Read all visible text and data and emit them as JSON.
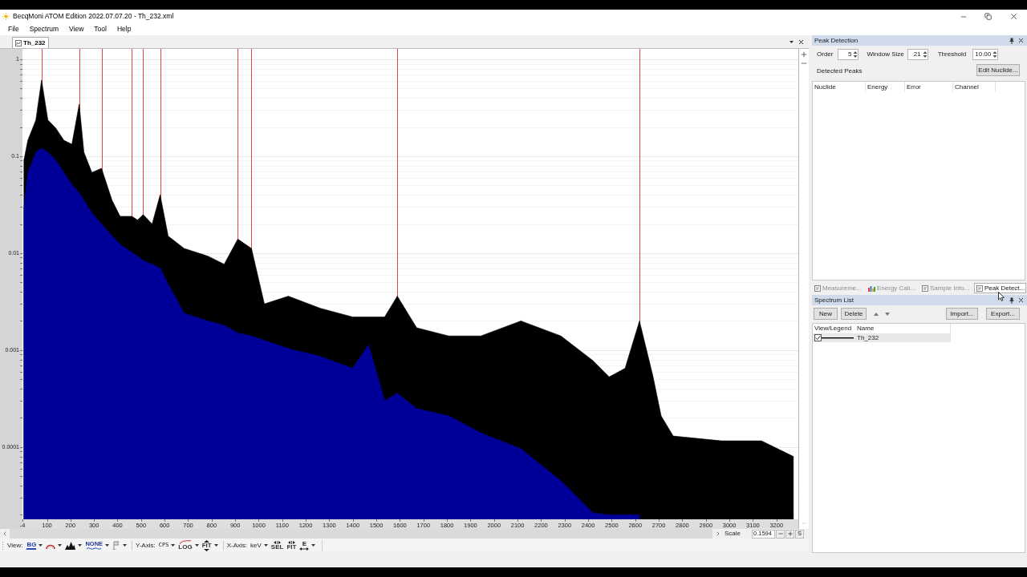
{
  "window": {
    "title": "BecqMoni ATOM Edition 2022.07.07.20 - Th_232.xml"
  },
  "menu": [
    "File",
    "Spectrum",
    "View",
    "Tool",
    "Help"
  ],
  "document_tabs": [
    {
      "label": "Th_232",
      "selected": true
    }
  ],
  "spectrum_view": {
    "chart_data": [
      {
        "type": "area",
        "log": true,
        "grid": true,
        "x": [
          2,
          19,
          53,
          77,
          104,
          138,
          172,
          206,
          237,
          257,
          291,
          332,
          377,
          411,
          461,
          485,
          509,
          547,
          581,
          615,
          683,
          785,
          853,
          911,
          969,
          1024,
          1126,
          1262,
          1399,
          1467,
          1535,
          1589,
          1671,
          1807,
          1944,
          2114,
          2284,
          2420,
          2489,
          2557,
          2618,
          2676,
          2710,
          2761,
          2966,
          3136,
          3272
        ],
        "series": [
          {
            "color": "#000000",
            "values": [
              0.091,
              0.146,
              0.236,
              0.61,
              0.236,
              0.195,
              0.146,
              0.133,
              0.344,
              0.11,
              0.068,
              0.075,
              0.035,
              0.024,
              0.024,
              0.022,
              0.025,
              0.02,
              0.04,
              0.015,
              0.0112,
              0.0093,
              0.0077,
              0.014,
              0.0112,
              0.003,
              0.0036,
              0.0027,
              0.0022,
              0.0022,
              0.0022,
              0.0036,
              0.0017,
              0.0014,
              0.0014,
              0.002,
              0.0014,
              0.00078,
              0.00053,
              0.00065,
              0.002,
              0.00053,
              0.00021,
              0.00013,
              0.000116,
              0.000116,
              8e-05
            ]
          },
          {
            "color": "#000099",
            "values": [
              0.029,
              0.068,
              0.11,
              0.121,
              0.11,
              0.091,
              0.068,
              0.051,
              0.042,
              0.035,
              0.026,
              0.02,
              0.015,
              0.0123,
              0.0102,
              0.0093,
              0.0084,
              0.0077,
              0.007,
              0.0048,
              0.0024,
              0.002,
              0.0018,
              0.0015,
              0.0014,
              0.00126,
              0.00104,
              0.00086,
              0.00065,
              0.00114,
              0.0003,
              0.00036,
              0.00025,
              0.00021,
              0.00014,
              9.6e-05,
              4.5e-05,
              2.1e-05,
              2e-05,
              2e-05,
              2e-05,
              null,
              null,
              null,
              null,
              null,
              null
            ]
          }
        ],
        "xlim": [
          -4,
          3293
        ],
        "ylim": [
          1.8e-05,
          1.28
        ],
        "xticks": [
          -4,
          100,
          200,
          300,
          400,
          500,
          600,
          700,
          800,
          900,
          1000,
          1100,
          1200,
          1300,
          1400,
          1500,
          1600,
          1700,
          1800,
          1900,
          2000,
          2100,
          2200,
          2300,
          2400,
          2500,
          2600,
          2700,
          2800,
          2900,
          3000,
          3100,
          3200
        ],
        "yticks": [
          1,
          0.1,
          0.01,
          0.001,
          0.0001
        ],
        "ref_lines": [
          {
            "axis": "x",
            "value": 77,
            "color": "#e04848"
          },
          {
            "axis": "x",
            "value": 237,
            "color": "#e04848"
          },
          {
            "axis": "x",
            "value": 332,
            "color": "#e04848"
          },
          {
            "axis": "x",
            "value": 461,
            "color": "#e04848"
          },
          {
            "axis": "x",
            "value": 509,
            "color": "#e04848"
          },
          {
            "axis": "x",
            "value": 581,
            "color": "#e04848"
          },
          {
            "axis": "x",
            "value": 911,
            "color": "#e04848"
          },
          {
            "axis": "x",
            "value": 969,
            "color": "#e04848"
          },
          {
            "axis": "x",
            "value": 1589,
            "color": "#e04848"
          },
          {
            "axis": "x",
            "value": 2618,
            "color": "#e04848"
          }
        ]
      }
    ],
    "scale": {
      "label": "Scale",
      "value": "0.1594",
      "reset": "S"
    }
  },
  "toolbar": {
    "view": {
      "label": "View:",
      "icon_texts": [
        "BG",
        "NONE"
      ]
    },
    "y_axis": {
      "label": "Y-Axis:",
      "unit": "CPS",
      "icon_texts": [
        "LOG",
        "FIT"
      ]
    },
    "x_axis": {
      "label": "X-Axis:",
      "unit": "keV",
      "icon_texts": [
        "SEL",
        "FIT",
        "E"
      ]
    }
  },
  "peak_detection": {
    "title": "Peak Detection",
    "params": [
      {
        "label": "Order",
        "value": "5"
      },
      {
        "label": "Window Size",
        "value": "21"
      },
      {
        "label": "Threshold",
        "value": "10.00"
      }
    ],
    "edit_button": "Edit Nuclide...",
    "list_label": "Detected Peaks",
    "columns": [
      "Nuclide",
      "Energy",
      "Error",
      "Channel"
    ]
  },
  "panel_tabs": [
    {
      "label": "Measureme...",
      "selected": false
    },
    {
      "label": "Energy Cali...",
      "selected": false
    },
    {
      "label": "Sample Info...",
      "selected": false
    },
    {
      "label": "Peak Detect...",
      "selected": true
    }
  ],
  "spectrum_list": {
    "title": "Spectrum List",
    "buttons": [
      "New",
      "Delete"
    ],
    "file_buttons": [
      "Import...",
      "Export..."
    ],
    "columns": [
      "View/Legend",
      "Name"
    ],
    "rows": [
      {
        "checked": true,
        "color": "#000000",
        "name": "Th_232",
        "selected": true
      }
    ]
  }
}
